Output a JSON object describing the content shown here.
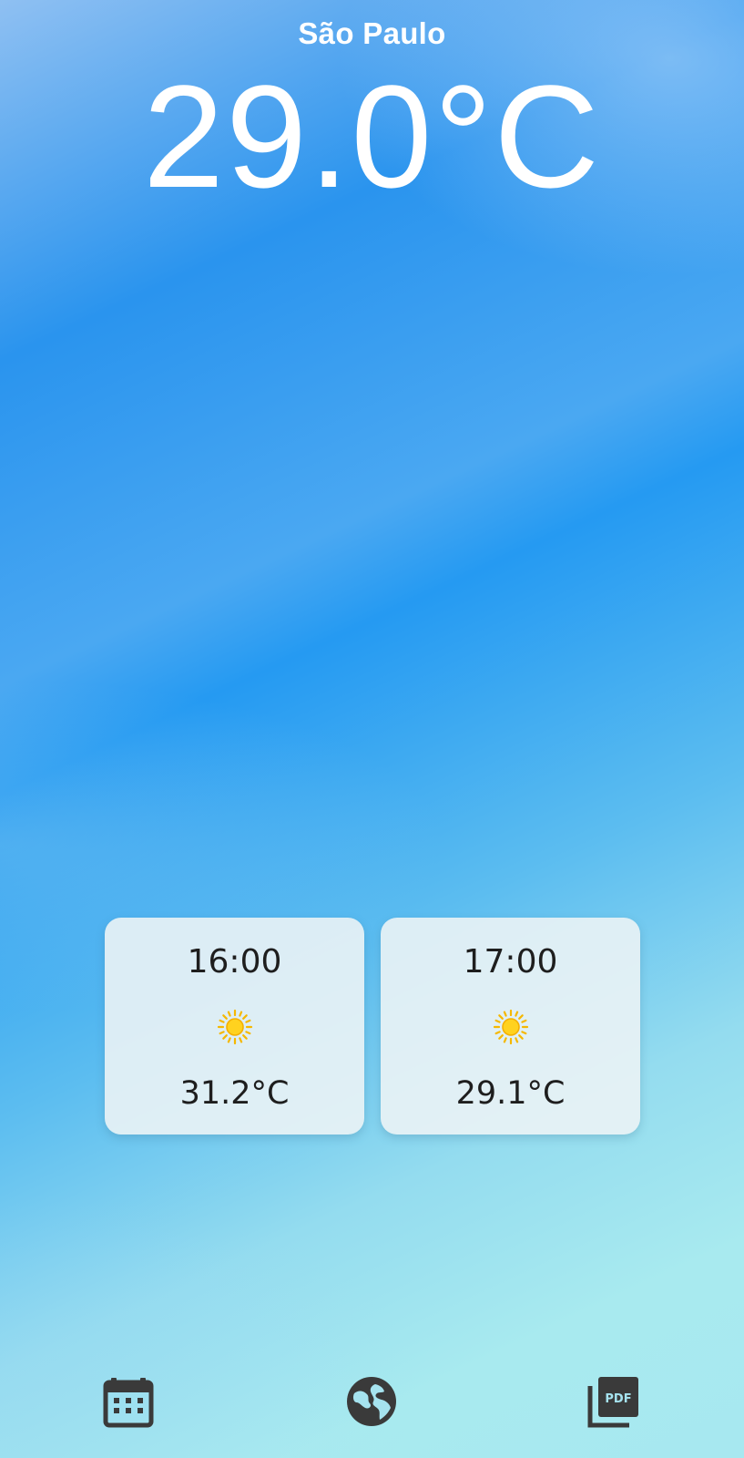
{
  "header": {
    "city": "São Paulo",
    "current_temperature": "29.0°C"
  },
  "forecast": [
    {
      "time": "16:00",
      "icon": "sun-icon",
      "temperature": "31.2°C"
    },
    {
      "time": "17:00",
      "icon": "sun-icon",
      "temperature": "29.1°C"
    }
  ],
  "bottom_nav": {
    "items": [
      {
        "icon": "calendar-icon"
      },
      {
        "icon": "globe-icon"
      },
      {
        "icon": "pdf-icon"
      }
    ]
  },
  "colors": {
    "sky_top": "#2a94ee",
    "sky_bottom": "#a8eaef",
    "card_background": "#ebf3f5",
    "sun": "#f8c81c",
    "icon": "#3a3a3a"
  }
}
